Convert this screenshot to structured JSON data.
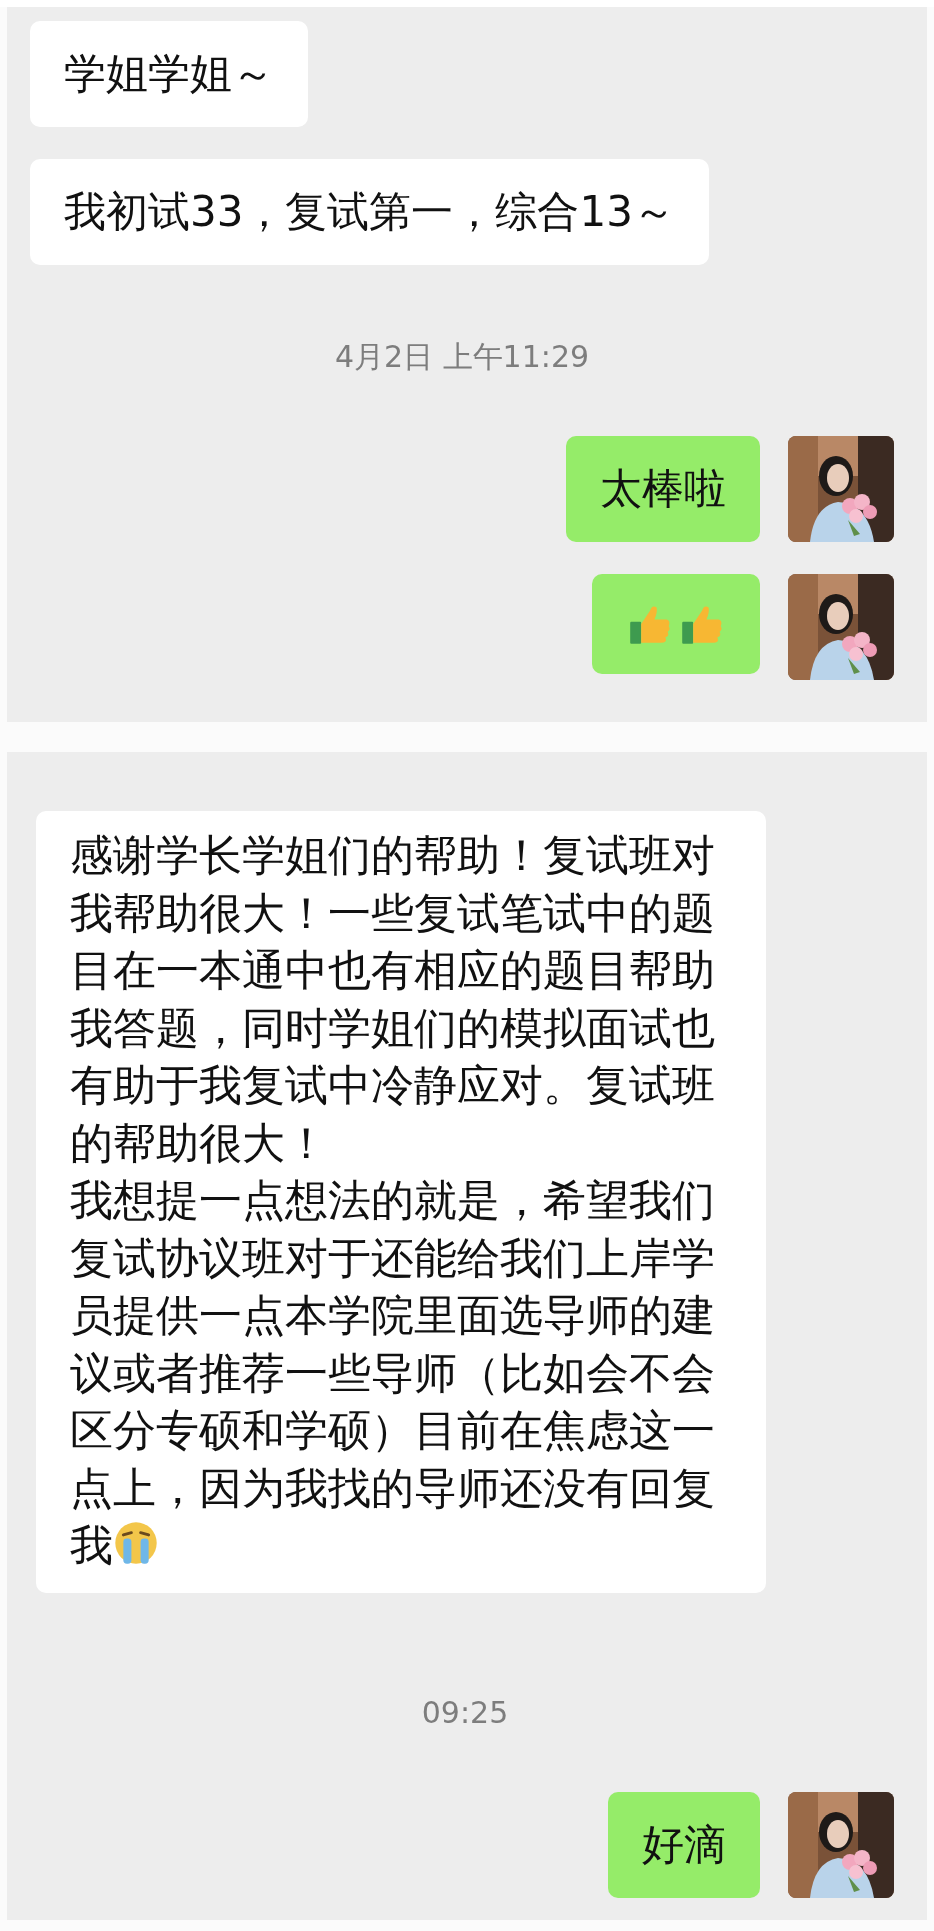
{
  "panels": [
    {
      "items": [
        {
          "kind": "received",
          "text": "学姐学姐～"
        },
        {
          "kind": "received",
          "text": "我初试33，复试第一，综合13～"
        },
        {
          "kind": "time",
          "text": "4月2日 上午11:29"
        },
        {
          "kind": "sent",
          "text": "太棒啦"
        },
        {
          "kind": "sent_icons"
        }
      ]
    },
    {
      "items": [
        {
          "kind": "received_long",
          "paragraphs": [
            "感谢学长学姐们的帮助！复试班对我帮助很大！一些复试笔试中的题目在一本通中也有相应的题目帮助我答题，同时学姐们的模拟面试也有助于我复试中冷静应对。复试班的帮助很大！",
            "我想提一点想法的就是，希望我们复试协议班对于还能给我们上岸学员提供一点本学院里面选导师的建议或者推荐一些导师（比如会不会区分专硕和学硕）目前在焦虑这一点上，因为我找的导师还没有回复我"
          ]
        },
        {
          "kind": "time",
          "text": "09:25"
        },
        {
          "kind": "sent",
          "text": "好滴"
        }
      ]
    }
  ]
}
